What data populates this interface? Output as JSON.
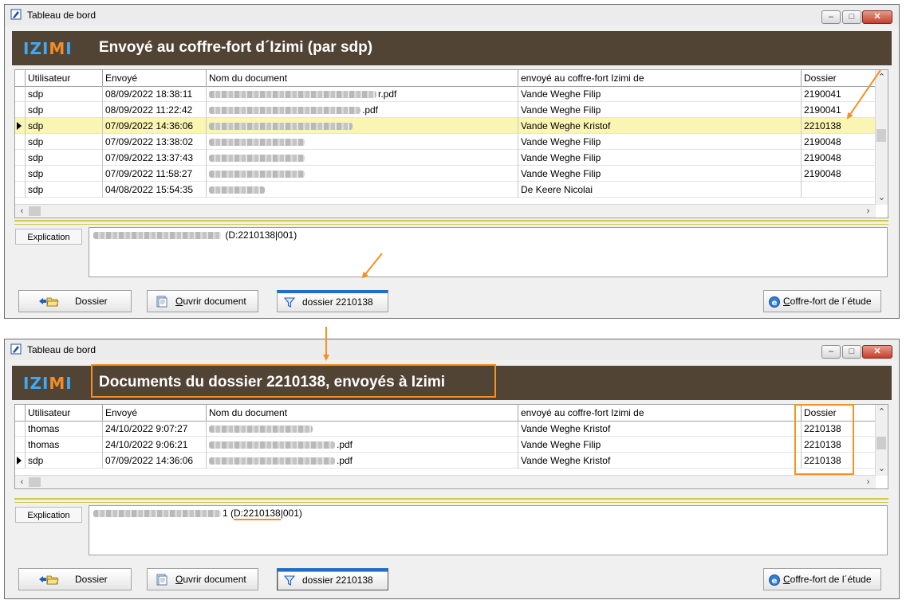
{
  "accent": "#f39221",
  "window_title": "Tableau de bord",
  "logo": {
    "part1": "IZI",
    "part2": "M",
    "part3": "I"
  },
  "columns": [
    "Utilisateur",
    "Envoyé",
    "Nom du document",
    "envoyé au coffre-fort Izimi de",
    "Dossier"
  ],
  "panel1": {
    "banner_title": "Envoyé au coffre-fort d´Izimi (par sdp)",
    "rows": [
      {
        "user": "sdp",
        "date": "08/09/2022 18:38:11",
        "doc": "r.pdf",
        "sender": "Vande Weghe Filip",
        "dossier": "2190041"
      },
      {
        "user": "sdp",
        "date": "08/09/2022 11:22:42",
        "doc": ".pdf",
        "sender": "Vande Weghe Filip",
        "dossier": "2190041"
      },
      {
        "user": "sdp",
        "date": "07/09/2022 14:36:06",
        "doc": "",
        "sender": "Vande Weghe Kristof",
        "dossier": "2210138"
      },
      {
        "user": "sdp",
        "date": "07/09/2022 13:38:02",
        "doc": "",
        "sender": "Vande Weghe Filip",
        "dossier": "2190048"
      },
      {
        "user": "sdp",
        "date": "07/09/2022 13:37:43",
        "doc": "",
        "sender": "Vande Weghe Filip",
        "dossier": "2190048"
      },
      {
        "user": "sdp",
        "date": "07/09/2022 11:58:27",
        "doc": "",
        "sender": "Vande Weghe Filip",
        "dossier": "2190048"
      },
      {
        "user": "sdp",
        "date": "04/08/2022 15:54:35",
        "doc": "",
        "sender": "De Keere Nicolai",
        "dossier": ""
      }
    ],
    "explanation_label": "Explication",
    "explanation_text": "(D:2210138|001)"
  },
  "panel2": {
    "banner_title": "Documents du dossier 2210138, envoyés à Izimi",
    "rows": [
      {
        "user": "thomas",
        "date": "24/10/2022 9:07:27",
        "doc": "",
        "sender": "Vande Weghe Kristof",
        "dossier": "2210138"
      },
      {
        "user": "thomas",
        "date": "24/10/2022 9:06:21",
        "doc": ".pdf",
        "sender": "Vande Weghe Filip",
        "dossier": "2210138"
      },
      {
        "user": "sdp",
        "date": "07/09/2022 14:36:06",
        "doc": ".pdf",
        "sender": "Vande Weghe Kristof",
        "dossier": "2210138"
      }
    ],
    "explanation_label": "Explication",
    "explanation_text_prefix": "1 (",
    "explanation_text_ref": "D:2210138",
    "explanation_text_suffix": "|001)"
  },
  "buttons": {
    "dossier": "Dossier",
    "open_doc_first": "O",
    "open_doc_rest": "uvrir document",
    "filter": "dossier 2210138",
    "safe_first": "C",
    "safe_rest": "offre-fort de l´étude"
  }
}
